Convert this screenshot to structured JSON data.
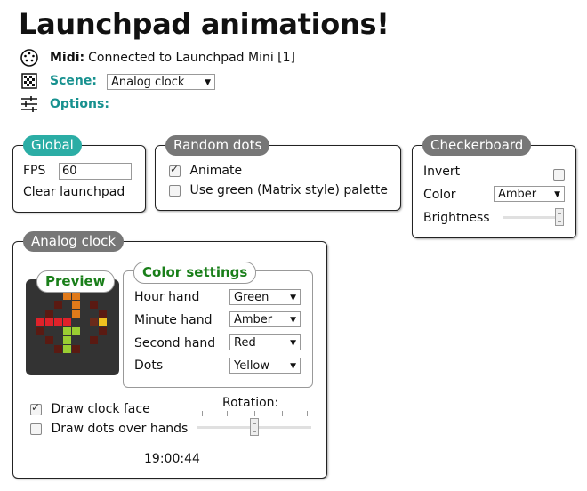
{
  "title": "Launchpad animations!",
  "header": {
    "midi_label": "Midi:",
    "midi_status": "Connected to Launchpad Mini [1]",
    "scene_label": "Scene:",
    "scene_value": "Analog clock",
    "options_label": "Options:"
  },
  "global": {
    "tag": "Global",
    "fps_label": "FPS",
    "fps_value": "60",
    "clear_link": "Clear launchpad"
  },
  "random_dots": {
    "tag": "Random dots",
    "animate_label": "Animate",
    "animate_checked": true,
    "green_label": "Use green (Matrix style) palette",
    "green_checked": false
  },
  "checkerboard": {
    "tag": "Checkerboard",
    "invert_label": "Invert",
    "invert_checked": false,
    "color_label": "Color",
    "color_value": "Amber",
    "brightness_label": "Brightness",
    "brightness_level": 1.0
  },
  "analog_clock": {
    "tag": "Analog clock",
    "preview_label": "Preview",
    "color_settings_label": "Color settings",
    "hour_label": "Hour hand",
    "hour_value": "Green",
    "minute_label": "Minute hand",
    "minute_value": "Amber",
    "second_label": "Second hand",
    "second_value": "Red",
    "dots_label": "Dots",
    "dots_value": "Yellow",
    "draw_face_label": "Draw clock face",
    "draw_face_checked": true,
    "draw_dots_label": "Draw dots over hands",
    "draw_dots_checked": false,
    "rotation_label": "Rotation:",
    "rotation_level": 0.5,
    "time": "19:00:44"
  },
  "colors": {
    "teal": "#2bada5",
    "gray_tag": "#777777",
    "green_text": "#1a7f1a"
  }
}
